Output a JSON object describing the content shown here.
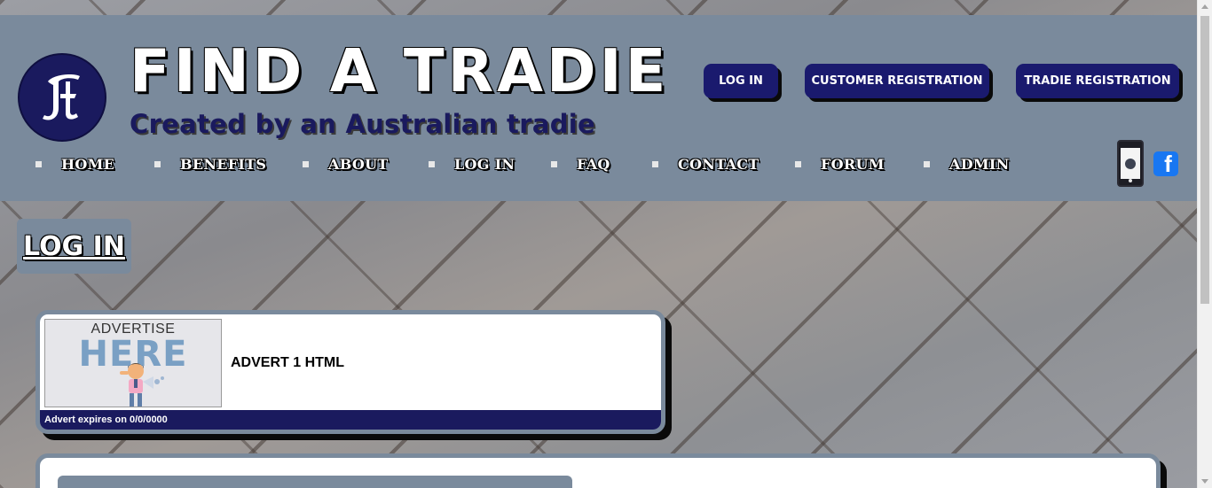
{
  "header": {
    "title": "FIND A TRADIE",
    "subtitle": "Created by an Australian tradie",
    "logo_letter": "F",
    "buttons": {
      "login": "LOG IN",
      "customer_registration": "CUSTOMER REGISTRATION",
      "tradie_registration": "TRADIE REGISTRATION"
    },
    "colors": {
      "bar": "#7a8a9c",
      "accent": "#1a1a6e"
    }
  },
  "nav": {
    "items": [
      {
        "label": "HOME"
      },
      {
        "label": "BENEFITS"
      },
      {
        "label": "ABOUT"
      },
      {
        "label": "LOG IN"
      },
      {
        "label": "FAQ"
      },
      {
        "label": "CONTACT"
      },
      {
        "label": "FORUM"
      },
      {
        "label": "ADMIN"
      }
    ]
  },
  "icons": {
    "phone": "mobile-phone-icon",
    "facebook": "facebook-icon",
    "facebook_glyph": "f"
  },
  "page": {
    "heading": "LOG IN"
  },
  "advert": {
    "image_top_text": "ADVERTISE",
    "image_big_text": "HERE",
    "content": "ADVERT 1 HTML",
    "expiry": "Advert expires on 0/0/0000"
  }
}
